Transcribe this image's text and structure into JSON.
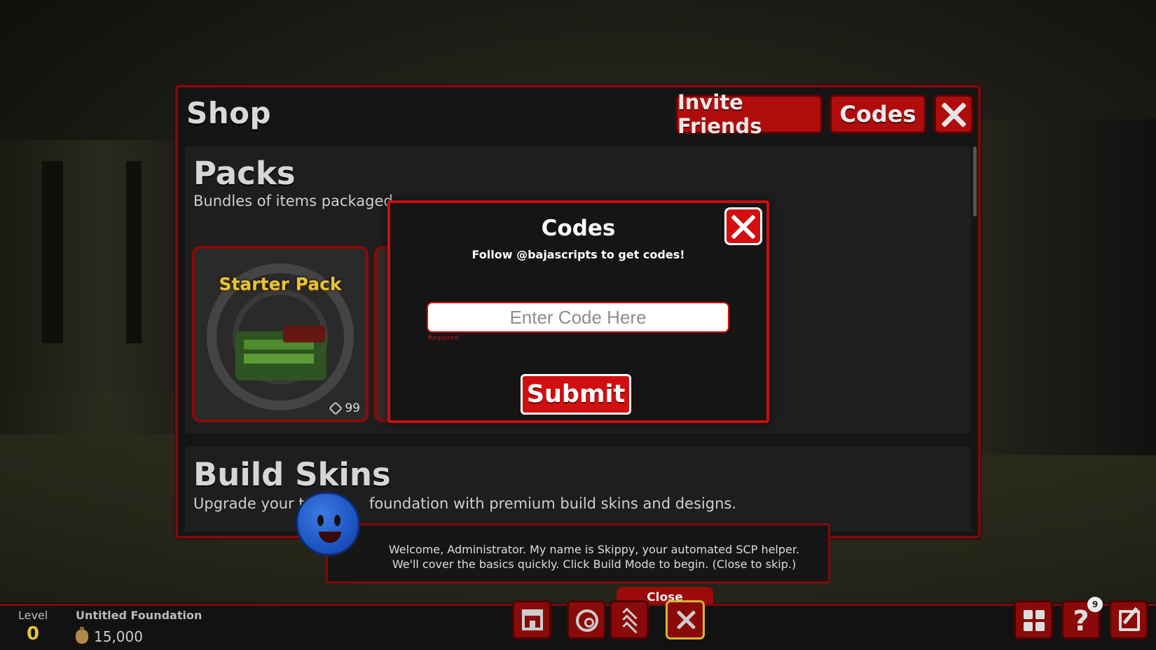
{
  "shop": {
    "title": "Shop",
    "invite_label": "Invite Friends",
    "codes_label": "Codes",
    "close_icon": "close-icon"
  },
  "packs": {
    "title": "Packs",
    "description": "Bundles of items packaged",
    "items": [
      {
        "name": "Starter Pack",
        "price": "99"
      },
      {
        "name": "",
        "price": ""
      }
    ]
  },
  "build_skins": {
    "title": "Build Skins",
    "description_start": "Upgrade your ty",
    "description_end": "foundation with premium build skins and designs."
  },
  "codes_modal": {
    "title": "Codes",
    "subtitle": "Follow @bajascripts to get codes!",
    "input_placeholder": "Enter Code Here",
    "input_value": "",
    "required_label": "Required",
    "submit_label": "Submit"
  },
  "tutorial": {
    "line1": "Welcome, Administrator. My name is Skippy, your automated SCP helper.",
    "line2": "We'll cover the basics quickly. Click Build Mode to begin. (Close to skip.)",
    "close_label": "Close"
  },
  "hud": {
    "level_label": "Level",
    "level_value": "0",
    "foundation_name": "Untitled Foundation",
    "money": "15,000",
    "help_badge": "9"
  },
  "colors": {
    "accent_red": "#b00c0c",
    "border_red": "#c80f0f",
    "gold": "#e5c33a"
  }
}
